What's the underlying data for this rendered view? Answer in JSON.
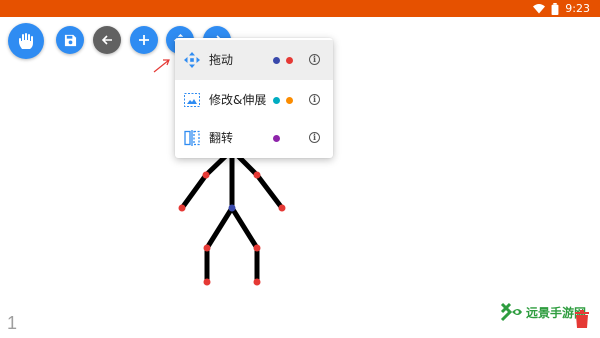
{
  "status_bar": {
    "time": "9:23",
    "wifi_icon": "wifi-icon",
    "battery_icon": "battery-icon",
    "color": "#e65100"
  },
  "toolbar": {
    "buttons": [
      {
        "name": "hand-mode",
        "icon": "hand-icon"
      },
      {
        "name": "save",
        "icon": "floppy-icon"
      },
      {
        "name": "back",
        "icon": "arrow-left-icon"
      },
      {
        "name": "add",
        "icon": "plus-icon"
      },
      {
        "name": "move",
        "icon": "move-icon"
      },
      {
        "name": "forward",
        "icon": "arrow-right-icon"
      }
    ],
    "accent_color": "#2f8cf2",
    "gray_color": "#616161"
  },
  "menu": {
    "items": [
      {
        "label": "拖动",
        "icon": "move-icon",
        "dots": [
          "#3949ab",
          "#e53935"
        ],
        "selected": true
      },
      {
        "label": "修改&伸展",
        "icon": "image-edit-icon",
        "dots": [
          "#00acc1",
          "#fb8c00"
        ],
        "selected": false
      },
      {
        "label": "翻转",
        "icon": "flip-icon",
        "dots": [
          "#8e24aa"
        ],
        "selected": false
      }
    ]
  },
  "canvas": {
    "figure": "stick-figure",
    "joint_color": "#e53935",
    "center_joint_color": "#3949ab",
    "line_color": "#000000"
  },
  "page_number": "1",
  "watermark": {
    "text": "远景手游网"
  },
  "trash": {
    "icon": "trash-icon",
    "color": "#e53935"
  }
}
